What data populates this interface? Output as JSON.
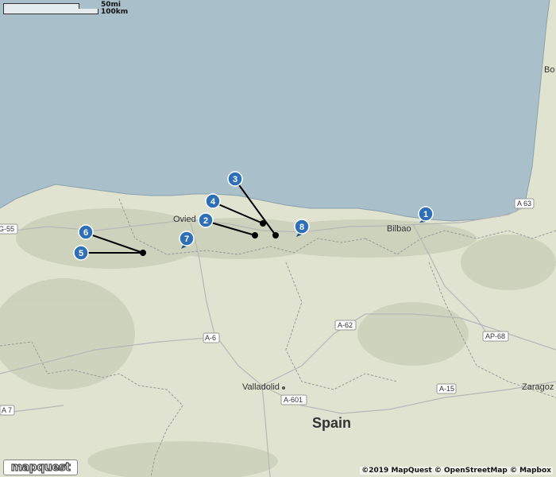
{
  "scale": {
    "miles_label": "50mi",
    "km_label": "100km"
  },
  "attribution": "©2019 MapQuest © OpenStreetMap © Mapbox",
  "logo_text": "mapquest",
  "colors": {
    "sea": "#a9bfca",
    "land": "#dfe3d0",
    "relief": "#c4cab4",
    "marker": "#2f6fb5",
    "connector": "#000000"
  },
  "places": {
    "spain": "Spain",
    "valladolid": "Valladolid",
    "bilbao": "Bilbao",
    "oviedo": "Ovied",
    "zaragoza": "Zaragoz",
    "bo": "Bo"
  },
  "roads": {
    "a63": "A 63",
    "a62": "A-62",
    "a6": "A-6",
    "a601": "A-601",
    "a15": "A-15",
    "ap68": "AP-68",
    "a7": "A 7",
    "g55": "G-55"
  },
  "markers": [
    {
      "label": "1"
    },
    {
      "label": "2"
    },
    {
      "label": "3"
    },
    {
      "label": "4"
    },
    {
      "label": "5"
    },
    {
      "label": "6"
    },
    {
      "label": "7"
    },
    {
      "label": "8"
    }
  ]
}
